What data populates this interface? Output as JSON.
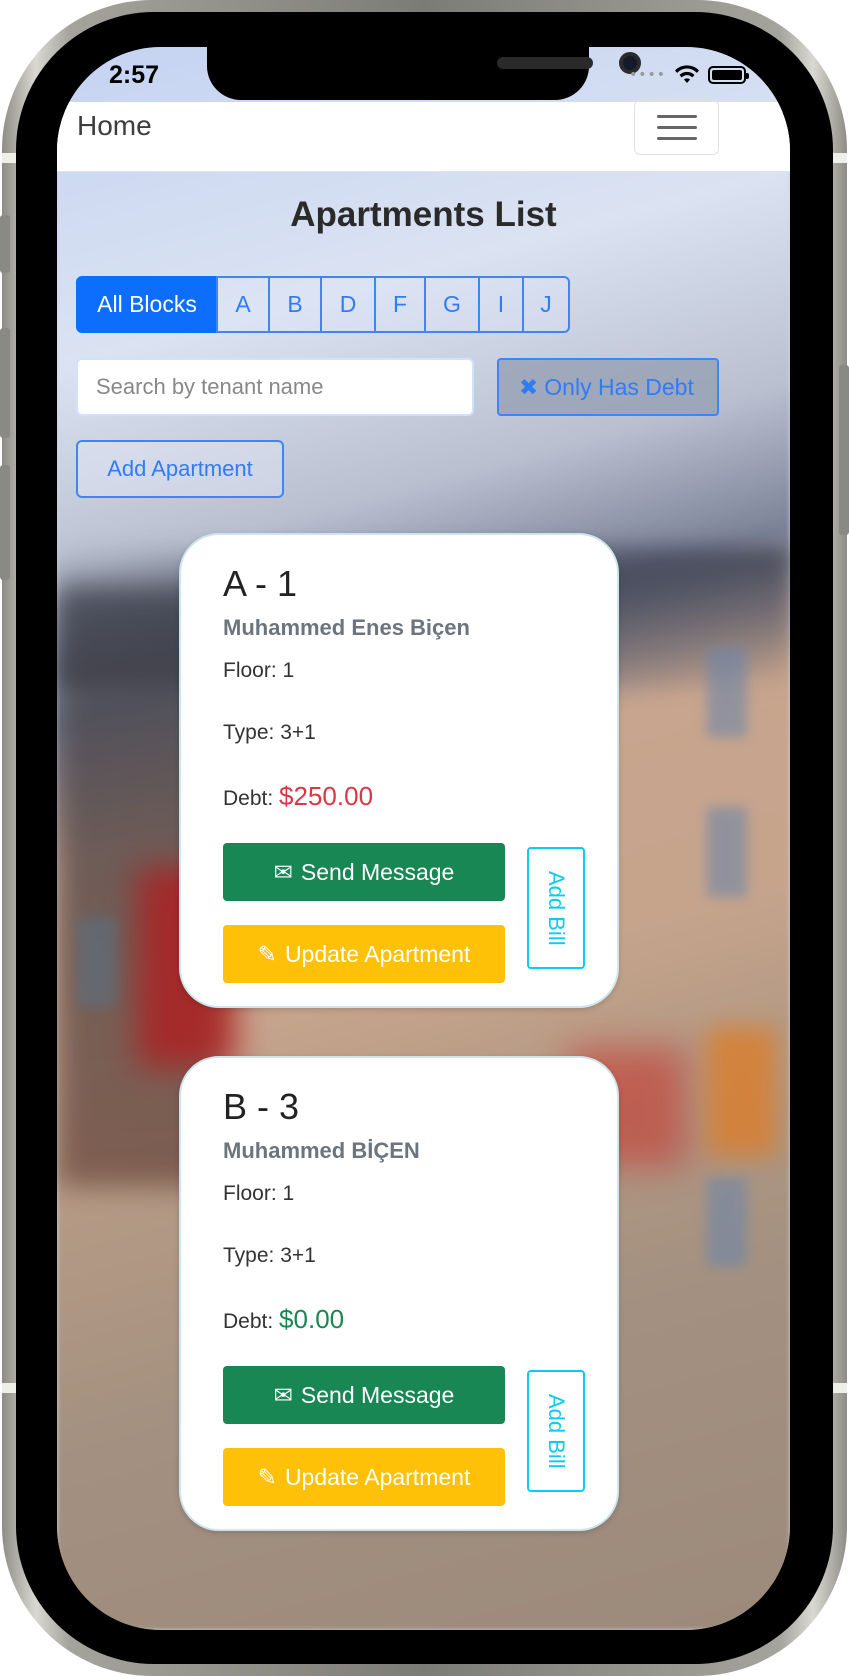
{
  "status_bar": {
    "time": "2:57"
  },
  "navbar": {
    "home_label": "Home"
  },
  "page": {
    "title": "Apartments List"
  },
  "blocks": [
    "All Blocks",
    "A",
    "B",
    "D",
    "F",
    "G",
    "I",
    "J"
  ],
  "blocks_selected": "All Blocks",
  "search": {
    "placeholder": "Search  by tenant name"
  },
  "filters": {
    "only_debt_label": "Only Has Debt"
  },
  "actions": {
    "add_apartment_label": "Add Apartment"
  },
  "apartments": [
    {
      "title": "A - 1",
      "tenant": "Muhammed Enes Biçen",
      "floor_label": "Floor: 1",
      "type_label": "Type: 3+1",
      "debt_label": "Debt:",
      "debt_value": "$250.00",
      "send_message_label": "Send Message",
      "update_label": "Update Apartment",
      "add_bill_label": "Add Bill"
    },
    {
      "title": "B - 3",
      "tenant": "Muhammed BİÇEN",
      "floor_label": "Floor: 1",
      "type_label": "Type: 3+1",
      "debt_label": "Debt:",
      "debt_value": "$0.00",
      "send_message_label": "Send Message",
      "update_label": "Update Apartment",
      "add_bill_label": "Add Bill"
    }
  ],
  "colors": {
    "primary": "#0d6efd",
    "success": "#198754",
    "warning": "#ffc107",
    "info": "#0dcaf0",
    "danger": "#dc3545"
  }
}
